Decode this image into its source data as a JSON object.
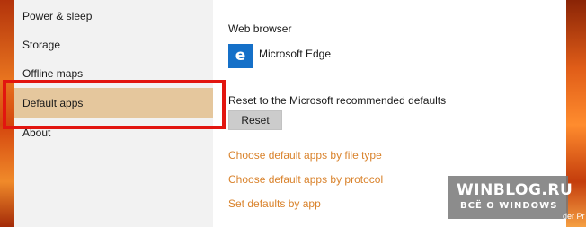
{
  "sidebar": {
    "items": [
      {
        "label": "Power & sleep"
      },
      {
        "label": "Storage"
      },
      {
        "label": "Offline maps"
      },
      {
        "label": "Default apps",
        "selected": true
      },
      {
        "label": "About"
      }
    ]
  },
  "main": {
    "web_browser_title": "Web browser",
    "web_browser_app": {
      "name": "Microsoft Edge",
      "icon": "edge-icon",
      "icon_glyph": "e"
    },
    "reset_label": "Reset to the Microsoft recommended defaults",
    "reset_button": "Reset",
    "links": [
      {
        "label": "Choose default apps by file type"
      },
      {
        "label": "Choose default apps by protocol"
      },
      {
        "label": "Set defaults by app"
      }
    ]
  },
  "watermark": {
    "title": "WINBLOG.RU",
    "subtitle": "ВСЁ О WINDOWS",
    "overflow_text": "der Pr"
  },
  "colors": {
    "accent_link": "#d9822b",
    "selected_bg": "#e5c79d",
    "highlight_border": "#e2150f",
    "edge_icon_bg": "#1570c8"
  }
}
